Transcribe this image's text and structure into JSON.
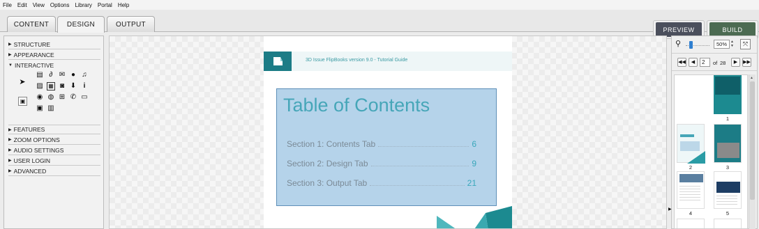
{
  "menu": [
    "File",
    "Edit",
    "View",
    "Options",
    "Library",
    "Portal",
    "Help"
  ],
  "tabs": [
    "CONTENT",
    "DESIGN",
    "OUTPUT"
  ],
  "buttons": {
    "preview": "PREVIEW",
    "build": "BUILD"
  },
  "sections_top": [
    "STRUCTURE",
    "APPEARANCE",
    "INTERACTIVE"
  ],
  "sections_bottom": [
    "FEATURES",
    "ZOOM OPTIONS",
    "AUDIO SETTINGS",
    "USER LOGIN",
    "ADVANCED"
  ],
  "page": {
    "header": "3D Issue FlipBooks version 9.0 - Tutorial Guide",
    "toc_title": "Table of Contents",
    "toc": [
      {
        "label": "Section 1: Contents Tab",
        "page": "6"
      },
      {
        "label": "Section 2: Design Tab",
        "page": "9"
      },
      {
        "label": "Section 3: Output Tab",
        "page": "21"
      }
    ]
  },
  "zoom": {
    "value": "50%"
  },
  "pager": {
    "current": "2",
    "of": "of",
    "total": "28"
  },
  "thumb_labels": [
    "1",
    "2",
    "3",
    "4",
    "5"
  ],
  "colors": {
    "accent_teal": "#1c7c86",
    "preview_btn": "#4b4f5c",
    "build_btn": "#4c6b52",
    "toc_highlight": "#b5d3ea"
  }
}
